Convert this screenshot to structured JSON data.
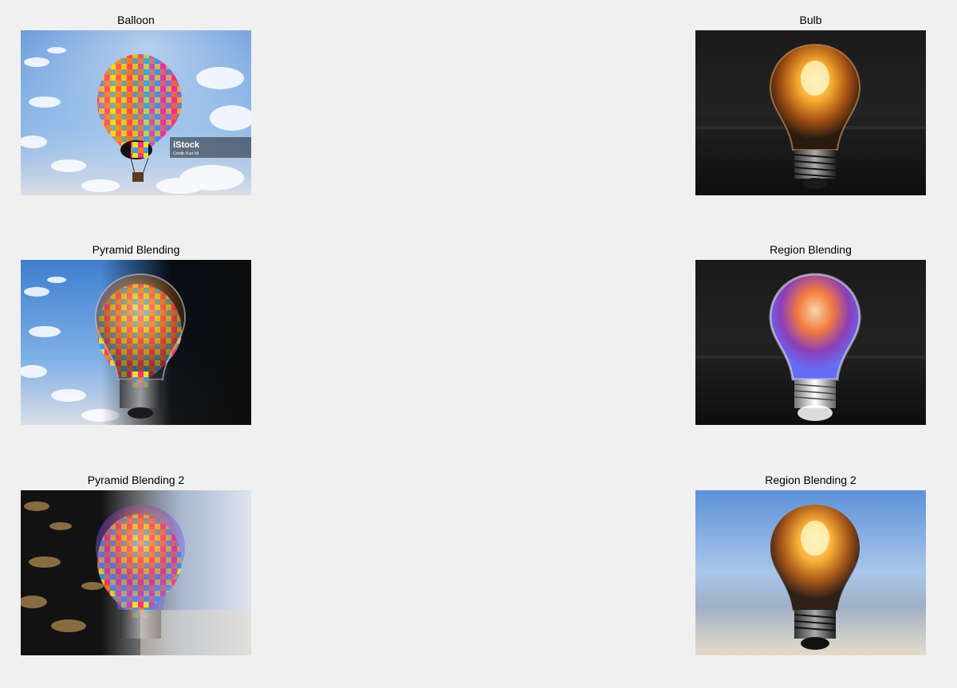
{
  "figure": {
    "background": "#f0f0f0",
    "panels": [
      {
        "title": "Balloon",
        "image": "balloon-photo"
      },
      {
        "title": "Bulb",
        "image": "bulb-photo"
      },
      {
        "title": "Pyramid Blending",
        "image": "pyramid-blend-photo"
      },
      {
        "title": "Region Blending",
        "image": "region-blend-photo"
      },
      {
        "title": "Pyramid Blending 2",
        "image": "pyramid-blend-2-photo"
      },
      {
        "title": "Region Blending 2",
        "image": "region-blend-2-photo"
      }
    ],
    "watermark": {
      "brand": "iStock",
      "credit": "Credit: Kurt Idl"
    }
  }
}
